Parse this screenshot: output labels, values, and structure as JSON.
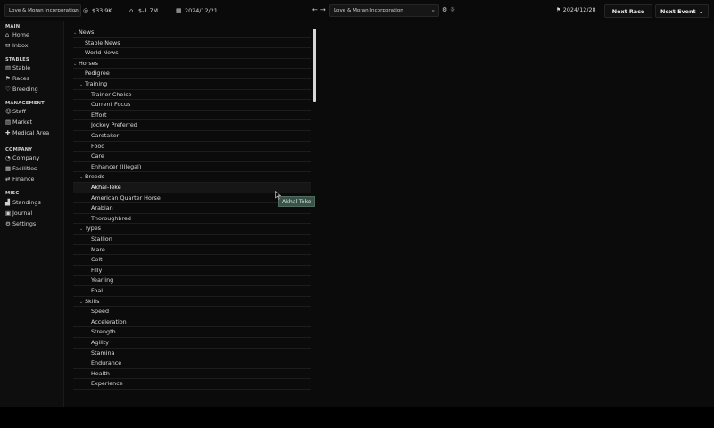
{
  "topbar": {
    "company": "Love & Moran Incorporation",
    "money": "$33.9K",
    "balance": "$-1.7M",
    "date": "2024/12/21",
    "search_value": "Love & Moran Incorporation",
    "flag_date": "2024/12/28",
    "next_race": "Next Race",
    "next_event": "Next Event"
  },
  "sidebar": {
    "sections": [
      {
        "title": "MAIN",
        "items": [
          {
            "label": "Home",
            "icon": "home-icon"
          },
          {
            "label": "Inbox",
            "icon": "inbox-icon"
          }
        ]
      },
      {
        "title": "STABLES",
        "items": [
          {
            "label": "Stable",
            "icon": "stable-icon"
          },
          {
            "label": "Races",
            "icon": "flag-icon"
          },
          {
            "label": "Breeding",
            "icon": "heart-icon"
          }
        ]
      },
      {
        "title": "MANAGEMENT",
        "items": [
          {
            "label": "Staff",
            "icon": "staff-icon"
          },
          {
            "label": "Market",
            "icon": "market-icon"
          },
          {
            "label": "Medical Area",
            "icon": "medical-icon"
          }
        ]
      },
      {
        "title": "COMPANY",
        "items": [
          {
            "label": "Company",
            "icon": "company-icon"
          },
          {
            "label": "Facilities",
            "icon": "facilities-icon"
          },
          {
            "label": "Finance",
            "icon": "finance-icon"
          }
        ]
      },
      {
        "title": "MISC",
        "items": [
          {
            "label": "Standings",
            "icon": "standings-icon"
          },
          {
            "label": "Journal",
            "icon": "journal-icon"
          },
          {
            "label": "Settings",
            "icon": "gear-icon"
          }
        ]
      }
    ]
  },
  "tree": [
    {
      "label": "News",
      "level": 0,
      "caret": true
    },
    {
      "label": "Stable News",
      "level": 1
    },
    {
      "label": "World News",
      "level": 1
    },
    {
      "label": "Horses",
      "level": 0,
      "caret": true
    },
    {
      "label": "Pedigree",
      "level": 1
    },
    {
      "label": "Training",
      "level": 1,
      "caret": true
    },
    {
      "label": "Trainer Choice",
      "level": 2
    },
    {
      "label": "Current Focus",
      "level": 2
    },
    {
      "label": "Effort",
      "level": 2
    },
    {
      "label": "Jockey Preferred",
      "level": 2
    },
    {
      "label": "Caretaker",
      "level": 2
    },
    {
      "label": "Food",
      "level": 2
    },
    {
      "label": "Care",
      "level": 2
    },
    {
      "label": "Enhancer (Illegal)",
      "level": 2
    },
    {
      "label": "Breeds",
      "level": 1,
      "caret": true
    },
    {
      "label": "Akhal-Teke",
      "level": 2,
      "selected": true
    },
    {
      "label": "American Quarter Horse",
      "level": 2
    },
    {
      "label": "Arabian",
      "level": 2
    },
    {
      "label": "Thoroughbred",
      "level": 2
    },
    {
      "label": "Types",
      "level": 1,
      "caret": true
    },
    {
      "label": "Stallion",
      "level": 2
    },
    {
      "label": "Mare",
      "level": 2
    },
    {
      "label": "Colt",
      "level": 2
    },
    {
      "label": "Filly",
      "level": 2
    },
    {
      "label": "Yearling",
      "level": 2
    },
    {
      "label": "Foal",
      "level": 2
    },
    {
      "label": "Skills",
      "level": 1,
      "caret": true
    },
    {
      "label": "Speed",
      "level": 2
    },
    {
      "label": "Acceleration",
      "level": 2
    },
    {
      "label": "Strength",
      "level": 2
    },
    {
      "label": "Agility",
      "level": 2
    },
    {
      "label": "Stamina",
      "level": 2
    },
    {
      "label": "Endurance",
      "level": 2
    },
    {
      "label": "Health",
      "level": 2
    },
    {
      "label": "Experience",
      "level": 2
    }
  ],
  "tooltip": "Akhal-Teke"
}
